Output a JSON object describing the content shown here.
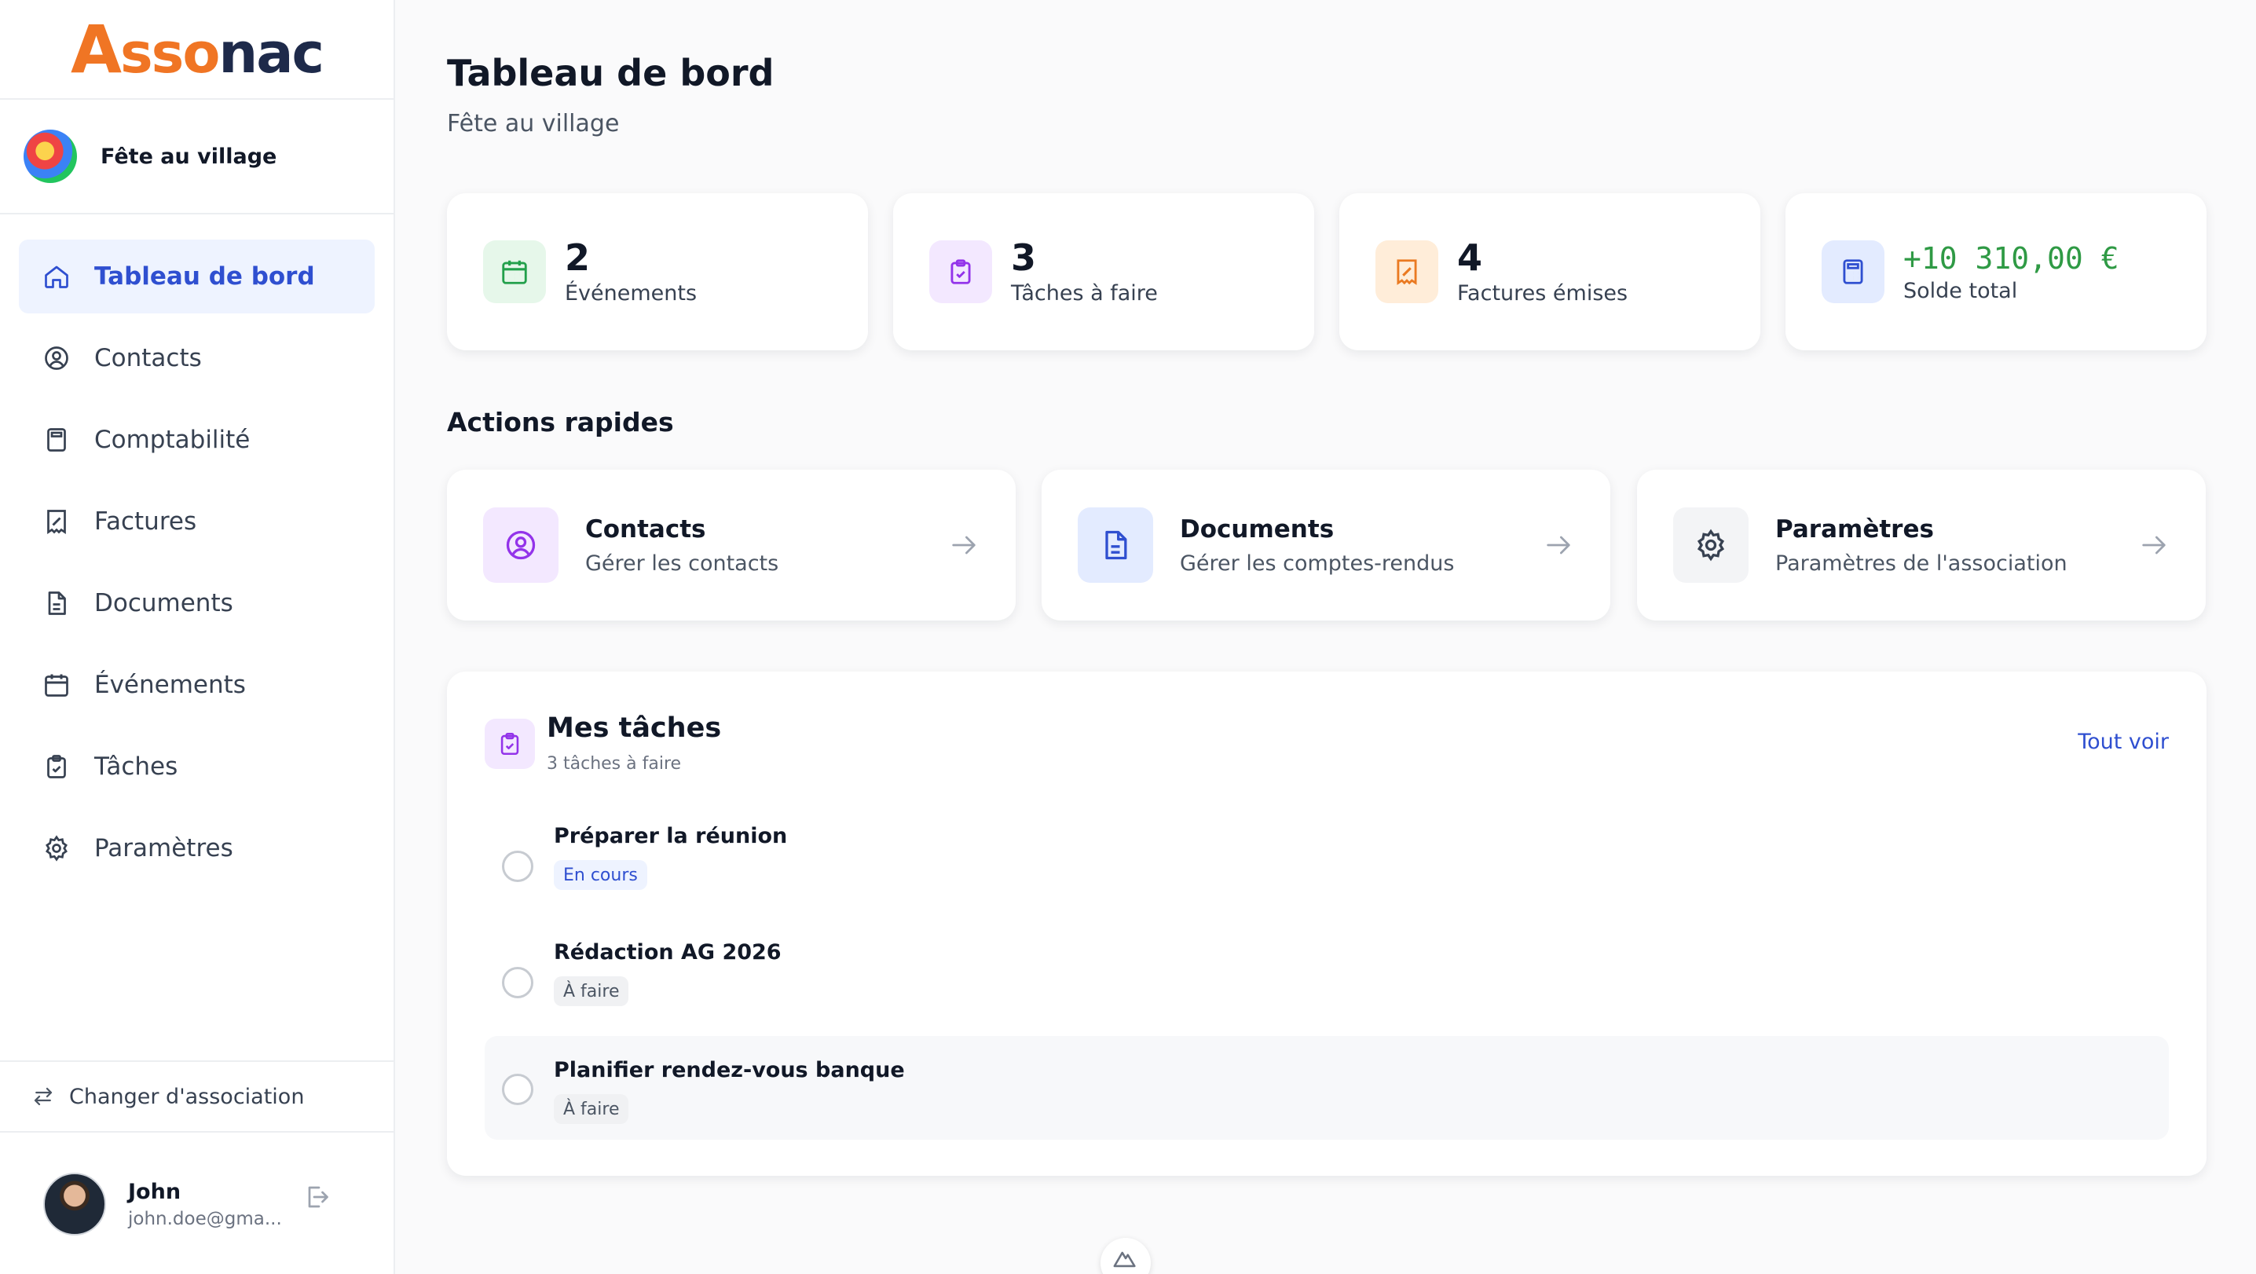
{
  "brand": {
    "logo_a": "A",
    "logo_sso": "sso",
    "logo_nac": "nac"
  },
  "association": {
    "name": "Fête au village"
  },
  "sidebar": {
    "items": [
      {
        "label": "Tableau de bord",
        "icon": "home-icon",
        "active": true
      },
      {
        "label": "Contacts",
        "icon": "user-circle-icon"
      },
      {
        "label": "Comptabilité",
        "icon": "calculator-icon"
      },
      {
        "label": "Factures",
        "icon": "receipt-icon"
      },
      {
        "label": "Documents",
        "icon": "document-icon"
      },
      {
        "label": "Événements",
        "icon": "calendar-icon"
      },
      {
        "label": "Tâches",
        "icon": "clipboard-check-icon"
      },
      {
        "label": "Paramètres",
        "icon": "gear-icon"
      }
    ],
    "switch_label": "Changer d'association"
  },
  "user": {
    "name": "John",
    "email": "john.doe@gma..."
  },
  "page": {
    "title": "Tableau de bord",
    "subtitle": "Fête au village"
  },
  "stats": [
    {
      "value": "2",
      "label": "Événements",
      "icon": "calendar-icon",
      "color": "#22a04b",
      "bg": "#e6f7ea"
    },
    {
      "value": "3",
      "label": "Tâches à faire",
      "icon": "clipboard-check-icon",
      "color": "#9333ea",
      "bg": "#f3e8ff"
    },
    {
      "value": "4",
      "label": "Factures émises",
      "icon": "receipt-icon",
      "color": "#ea7a22",
      "bg": "#ffedd9"
    },
    {
      "value": "+10 310,00 €",
      "label": "Solde total",
      "icon": "calculator-icon",
      "color": "#2f4fd0",
      "bg": "#e3ebff",
      "value_color": "#2f9a45"
    }
  ],
  "quick_actions": {
    "title": "Actions rapides",
    "items": [
      {
        "title": "Contacts",
        "subtitle": "Gérer les contacts",
        "icon": "user-circle-icon",
        "color": "#9333ea",
        "bg": "#f3e8ff"
      },
      {
        "title": "Documents",
        "subtitle": "Gérer les comptes-rendus",
        "icon": "document-icon",
        "color": "#2f4fd0",
        "bg": "#e3ebff"
      },
      {
        "title": "Paramètres",
        "subtitle": "Paramètres de l'association",
        "icon": "gear-icon",
        "color": "#374151",
        "bg": "#f3f4f6"
      }
    ]
  },
  "tasks": {
    "title": "Mes tâches",
    "subtitle": "3 tâches à faire",
    "see_all": "Tout voir",
    "items": [
      {
        "title": "Préparer la réunion",
        "status": "En cours"
      },
      {
        "title": "Rédaction AG 2026",
        "status": "À faire"
      },
      {
        "title": "Planifier rendez-vous banque",
        "status": "À faire"
      }
    ]
  },
  "colors": {
    "accent": "#2f4fd0",
    "brand_orange": "#f07524",
    "brand_navy": "#1e2a4a",
    "success": "#2f9a45"
  }
}
